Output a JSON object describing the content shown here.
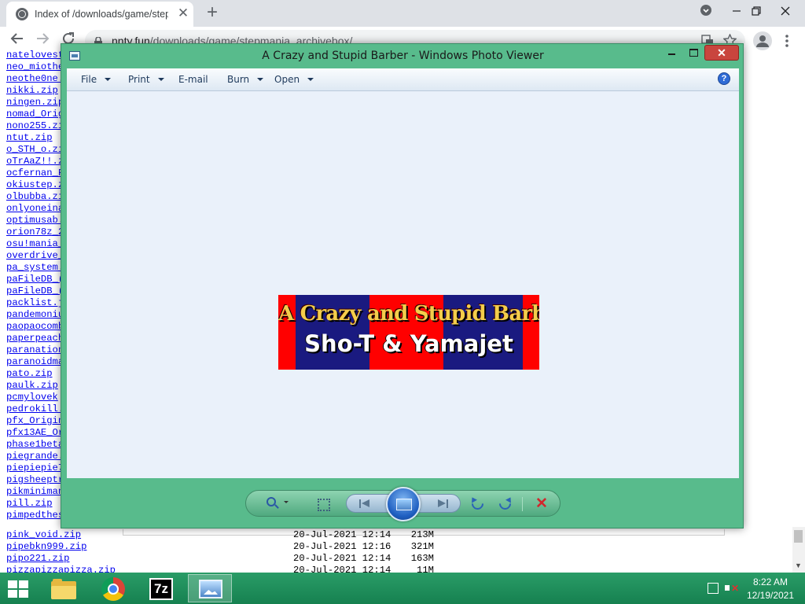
{
  "browser": {
    "tab_title": "Index of /downloads/game/stepmania_archivebox/",
    "tab_close": "✕",
    "new_tab": "+",
    "url_host": "nnty.fun",
    "url_path": "/downloads/game/stepmania_archivebox/",
    "icons": [
      "globe-icon",
      "back-arrow-icon",
      "forward-arrow-icon",
      "reload-icon",
      "lock-icon",
      "translate-icon",
      "star-icon",
      "profile-icon",
      "menu-dots-icon"
    ]
  },
  "listing": {
    "files": [
      "natelovest",
      "neo_miothe",
      "neothe0ne.",
      "nikki.zip",
      "ningen.zip",
      "nomad_Orig",
      "nono255.zi",
      "ntut.zip",
      "o_STH_o.zi",
      "oTrAaZ!!.z",
      "ocfernan_F",
      "okiustep.z",
      "olbubba.zi",
      "onlyoneina",
      "optimusab.",
      "orion78z_2",
      "osu!mania_",
      "overdrive_",
      "pa_system.",
      "paFileDB_(",
      "paFileDB_(",
      "packlist.j",
      "pandemoniu",
      "paopaocomb",
      "paperpeach",
      "paranation",
      "paranoidma",
      "pato.zip",
      "paulk.zip",
      "pcmylovek",
      "pedrokill.",
      "pfx_Origin",
      "pfx13AE_Or",
      "phase1beta",
      "piegrande.",
      "piepiepie7",
      "pigsheeptr",
      "pikminiman",
      "pill.zip",
      "pimpedthes"
    ],
    "bottom_rows": [
      {
        "name": "pink_void.zip",
        "date": "20-Jul-2021 12:14",
        "size": "213M"
      },
      {
        "name": "pipebkn999.zip",
        "date": "20-Jul-2021 12:16",
        "size": "321M"
      },
      {
        "name": "pipo221.zip",
        "date": "20-Jul-2021 12:14",
        "size": "163M"
      },
      {
        "name": "pizzapizzapizza.zip",
        "date": "20-Jul-2021 12:14",
        "size": "11M"
      }
    ]
  },
  "viewer": {
    "title": "A Crazy and Stupid Barber - Windows Photo Viewer",
    "close_label": "✕",
    "help_label": "?",
    "menu": [
      {
        "label": "File"
      },
      {
        "label": "Print"
      },
      {
        "label": "E-mail"
      },
      {
        "label": "Burn"
      },
      {
        "label": "Open"
      }
    ],
    "image": {
      "line1": "A Crazy and Stupid Barber",
      "line2": "Sho-T & Yamajet",
      "colors": {
        "red": "#ff0000",
        "navy": "#1a1a80",
        "title_gold": "#f4cd4b"
      }
    },
    "controls": [
      "zoom-icon",
      "fit-to-window-icon",
      "previous-icon",
      "slideshow-icon",
      "next-icon",
      "rotate-left-icon",
      "rotate-right-icon",
      "delete-icon"
    ],
    "delete_label": "✕"
  },
  "taskbar": {
    "apps": [
      "file-explorer-icon",
      "chrome-icon",
      "7zip-icon",
      "photo-viewer-icon"
    ],
    "sevenzip_label": "7z",
    "time": "8:22 AM",
    "date": "12/19/2021"
  },
  "colors": {
    "viewer_frame": "#58bb8c",
    "taskbar": "#1e8e5a",
    "close_red": "#c9453e"
  }
}
